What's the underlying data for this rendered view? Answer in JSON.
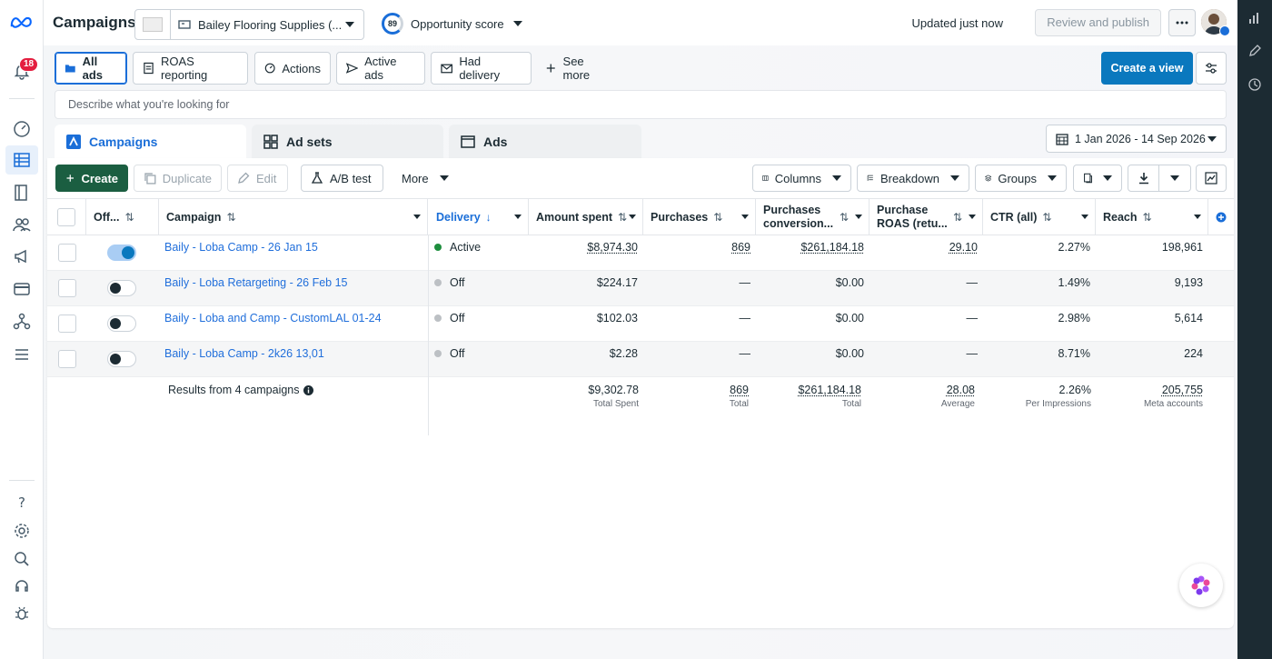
{
  "header": {
    "title": "Campaigns",
    "account_name": "Bailey Flooring Supplies (...",
    "score_value": "89",
    "score_label": "Opportunity score",
    "updated_text": "Updated just now",
    "review_label": "Review and publish",
    "notification_count": "18"
  },
  "filters": {
    "chips": [
      "All ads",
      "ROAS reporting",
      "Actions",
      "Active ads",
      "Had delivery",
      "See more"
    ],
    "create_view_label": "Create a view",
    "search_placeholder": "Describe what you're looking for"
  },
  "level_tabs": [
    "Campaigns",
    "Ad sets",
    "Ads"
  ],
  "date_range": "1 Jan 2026 - 14 Sep 2026",
  "toolbar": {
    "create": "Create",
    "duplicate": "Duplicate",
    "edit": "Edit",
    "ab_test": "A/B test",
    "more": "More",
    "columns": "Columns",
    "breakdown": "Breakdown",
    "groups": "Groups"
  },
  "columns": {
    "offon": "Off...",
    "campaign": "Campaign",
    "delivery": "Delivery",
    "amount_spent": "Amount spent",
    "purchases": "Purchases",
    "purchases_conv_1": "Purchases",
    "purchases_conv_2": "conversion...",
    "roas_1": "Purchase",
    "roas_2": "ROAS (retu...",
    "ctr": "CTR (all)",
    "reach": "Reach"
  },
  "rows": [
    {
      "name": "Baily - Loba Camp - 26 Jan 15",
      "delivery": "Active",
      "spent": "$8,974.30",
      "purchases": "869",
      "conv_value": "$261,184.18",
      "roas": "29.10",
      "ctr": "2.27%",
      "reach": "198,961",
      "on": true
    },
    {
      "name": "Baily - Loba Retargeting - 26 Feb 15",
      "delivery": "Off",
      "spent": "$224.17",
      "purchases": "—",
      "conv_value": "$0.00",
      "roas": "—",
      "ctr": "1.49%",
      "reach": "9,193",
      "on": false
    },
    {
      "name": "Baily - Loba and Camp - CustomLAL 01-24",
      "delivery": "Off",
      "spent": "$102.03",
      "purchases": "—",
      "conv_value": "$0.00",
      "roas": "—",
      "ctr": "2.98%",
      "reach": "5,614",
      "on": false
    },
    {
      "name": "Baily - Loba Camp - 2k26 13,01",
      "delivery": "Off",
      "spent": "$2.28",
      "purchases": "—",
      "conv_value": "$0.00",
      "roas": "—",
      "ctr": "8.71%",
      "reach": "224",
      "on": false
    }
  ],
  "totals": {
    "results_label": "Results from 4 campaigns",
    "spent": "$9,302.78",
    "spent_sub": "Total Spent",
    "purchases": "869",
    "purchases_sub": "Total",
    "conv_value": "$261,184.18",
    "conv_value_sub": "Total",
    "roas": "28.08",
    "roas_sub": "Average",
    "ctr": "2.26%",
    "ctr_sub": "Per Impressions",
    "reach": "205,755",
    "reach_sub": "Meta accounts"
  },
  "colors": {
    "accent": "#1a6ed8",
    "create_green": "#1b5e41",
    "active_dot": "#1e8e3e",
    "off_dot": "#bcc0c4"
  }
}
